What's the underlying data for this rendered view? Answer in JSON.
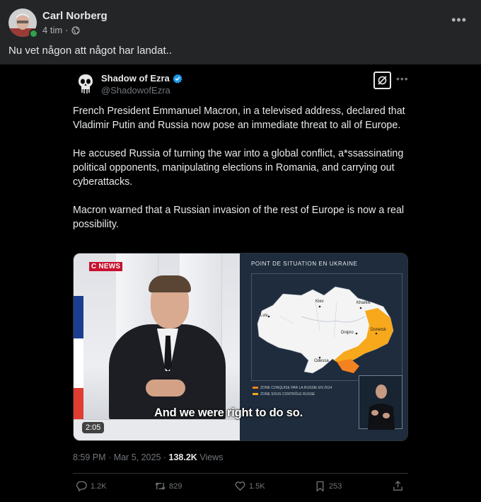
{
  "facebook_post": {
    "author": "Carl Norberg",
    "time": "4 tim",
    "separator": "·",
    "text": "Nu vet någon att något har landat..",
    "more_icon": "more-horizontal-icon",
    "privacy_icon": "globe-icon"
  },
  "tweet": {
    "display_name": "Shadow of Ezra",
    "handle": "@ShadowofEzra",
    "verified_color": "#1d9bf0",
    "paragraphs": [
      "French President Emmanuel Macron, in a televised address, declared that Vladimir Putin and Russia now pose an immediate threat to all of Europe.",
      "He accused Russia of turning the war into a global conflict, a*ssassinating political opponents, manipulating elections in Romania, and carrying out cyberattacks.",
      "Macron warned that a Russian invasion of the rest of Europe is now a real possibility."
    ],
    "video": {
      "channel_logo": "C NEWS",
      "map_title": "POINT DE SITUATION EN UKRAINE",
      "map_cities": [
        "Lviv",
        "Kiev",
        "Kharkiv",
        "Dnipro",
        "Donetsk",
        "Odessa"
      ],
      "legend": [
        "ZONE CONQUISE PAR LA RUSSIE EN 2014",
        "ZONE SOUS CONTRÔLE RUSSE"
      ],
      "subtitle": "And we were right to do so.",
      "duration": "2:05"
    },
    "time": "8:59 PM",
    "date": "Mar 5, 2025",
    "views_count": "138.2K",
    "views_label": "Views",
    "replies": "1.2K",
    "retweets": "829",
    "likes": "1.5K",
    "bookmarks": "253"
  }
}
